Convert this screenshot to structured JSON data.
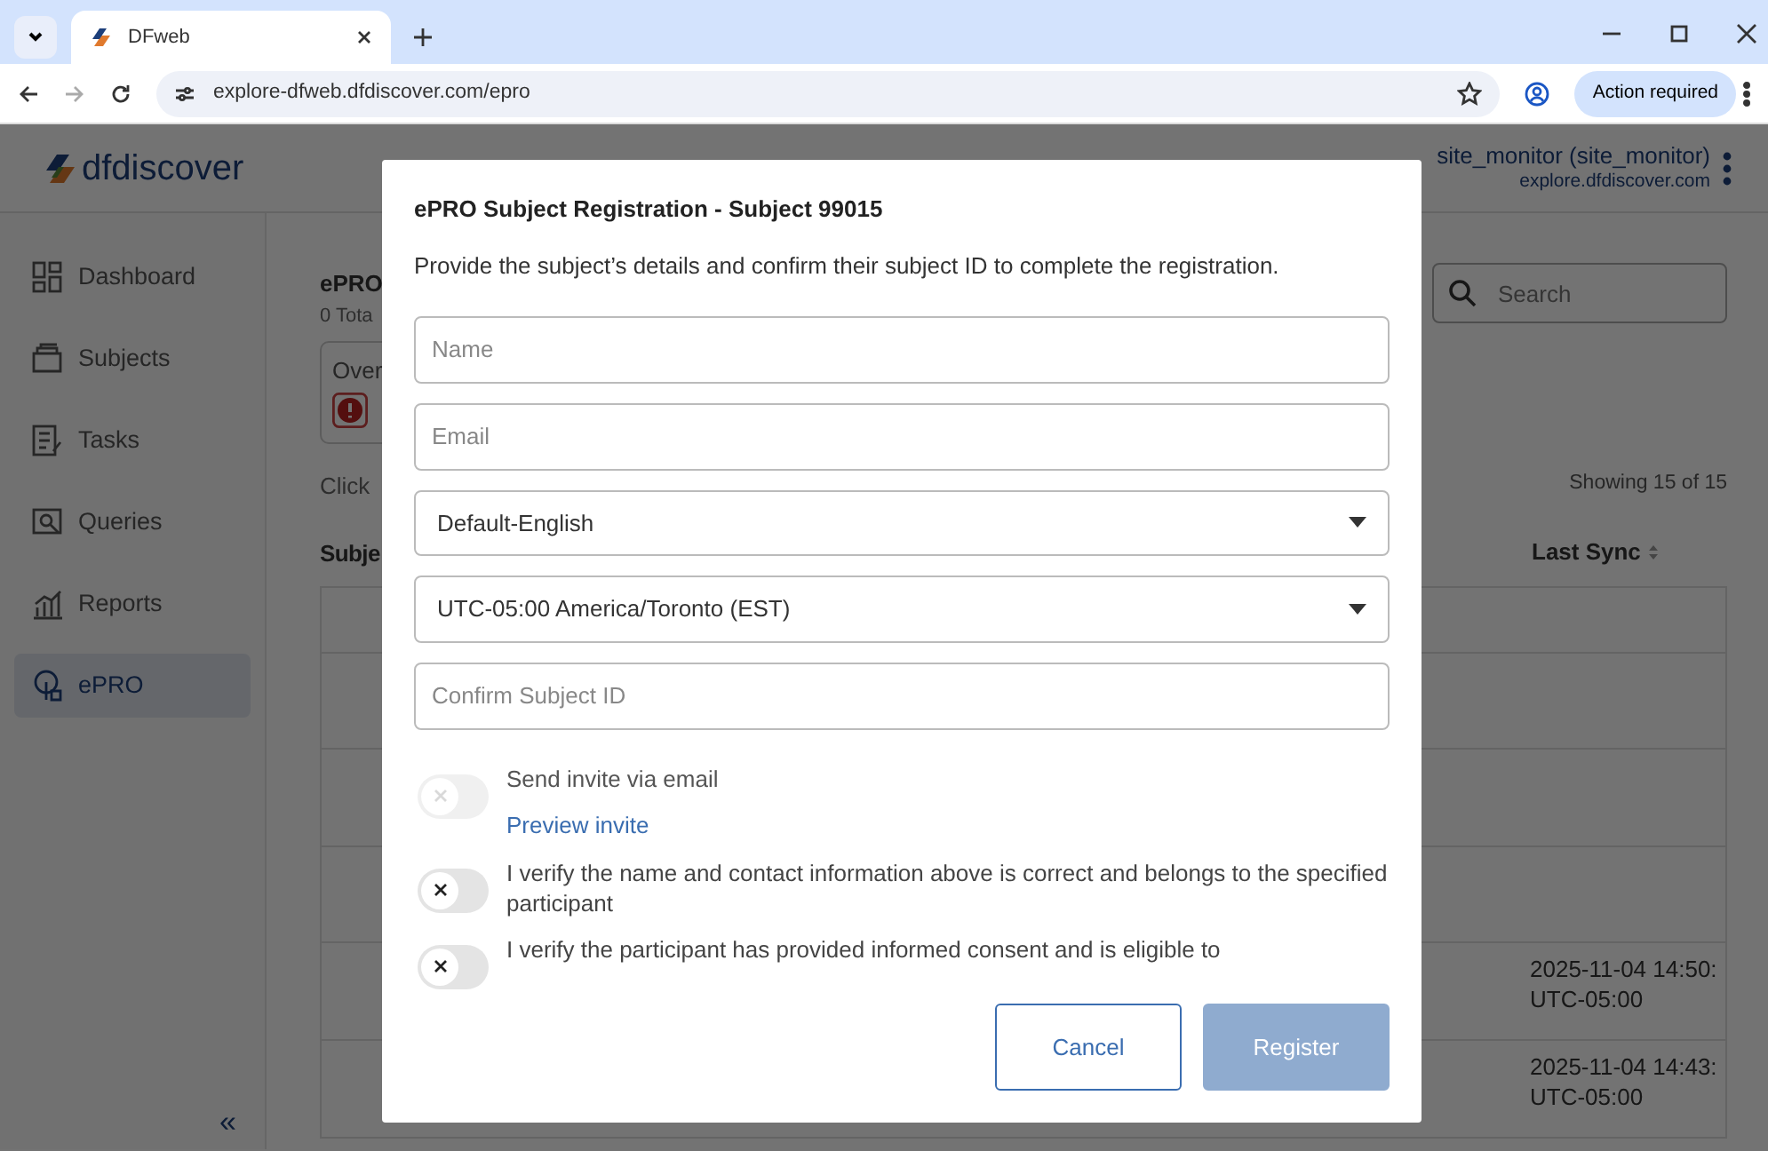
{
  "browser": {
    "tabs": [
      {
        "title": "DFweb",
        "selected": true
      }
    ],
    "url": "explore-dfweb.dfdiscover.com/epro",
    "profile_button": "Action required"
  },
  "app": {
    "logo": "dfdiscover",
    "user": "site_monitor (site_monitor)",
    "host": "explore.dfdiscover.com",
    "collapse": "«"
  },
  "sidebar": {
    "items": [
      {
        "label": "Dashboard",
        "selected": false
      },
      {
        "label": "Subjects",
        "selected": false
      },
      {
        "label": "Tasks",
        "selected": false
      },
      {
        "label": "Queries",
        "selected": false
      },
      {
        "label": "Reports",
        "selected": false
      },
      {
        "label": "ePRO",
        "selected": true
      }
    ]
  },
  "page": {
    "title": "ePRO",
    "subtitle": "0 Tota",
    "overview_card": {
      "label": "Over"
    },
    "hint": "Click",
    "search": {
      "placeholder": "Search"
    },
    "count": "Showing 15 of 15",
    "table": {
      "columns": [
        "Subje",
        "Last Sync"
      ],
      "rows": [
        {},
        {},
        {},
        {},
        {
          "last_sync": "2025-11-04 14:50:",
          "timezone": "UTC-05:00"
        },
        {
          "last_sync": "2025-11-04 14:43:",
          "timezone": "UTC-05:00"
        }
      ]
    }
  },
  "modal": {
    "title": "ePRO Subject Registration - Subject 99015",
    "description": "Provide the subject’s details and confirm their subject ID to complete the registration.",
    "fields": [
      {
        "kind": "text",
        "placeholder": "Name"
      },
      {
        "kind": "text",
        "placeholder": "Email"
      },
      {
        "kind": "select",
        "value": "Default-English"
      },
      {
        "kind": "select",
        "value": "UTC-05:00 America/Toronto (EST)"
      },
      {
        "kind": "text",
        "placeholder": "Confirm Subject ID"
      }
    ],
    "toggles": [
      {
        "label": "Send invite via email",
        "on": false,
        "disabled": true,
        "link": "Preview invite"
      },
      {
        "label": "I verify the name and contact information above is correct and belongs to the specified participant",
        "on": false,
        "disabled": false
      },
      {
        "label": "I verify the participant has provided informed consent and is eligible to",
        "on": false,
        "disabled": false
      }
    ],
    "buttons": [
      {
        "label": "Cancel",
        "kind": "outline"
      },
      {
        "label": "Register",
        "kind": "primary",
        "disabled": true
      }
    ]
  }
}
